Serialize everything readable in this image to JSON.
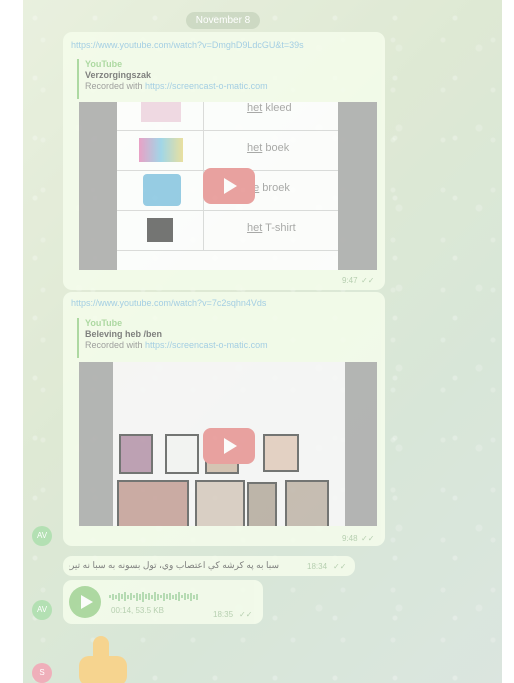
{
  "date_separator": "November 8",
  "messages": [
    {
      "link": "https://www.youtube.com/watch?v=DmghD9LdcGU&t=39s",
      "site": "YouTube",
      "title": "Verzorgingszak",
      "desc_prefix": "Recorded with ",
      "desc_link": "https://screencast-o-matic.com",
      "time": "9:47",
      "video_rows": [
        {
          "article": "het",
          "noun": " kleed"
        },
        {
          "article": "het",
          "noun": " boek"
        },
        {
          "article": "de",
          "noun": " broek"
        },
        {
          "article": "het",
          "noun": " T-shirt"
        }
      ]
    },
    {
      "link": "https://www.youtube.com/watch?v=7c2sqhn4Vds",
      "site": "YouTube",
      "title": "Beleving heb /ben",
      "desc_prefix": "Recorded with ",
      "desc_link": "https://screencast-o-matic.com",
      "time": "9:48"
    },
    {
      "text": "سبا به په کرشه کې اعتصاب وي، تول بسونه به سبا نه تيريږي.",
      "time": "18:34"
    },
    {
      "voice_meta": "00:14, 53.5 KB",
      "time": "18:35"
    }
  ],
  "avatars": [
    {
      "initials": "AV",
      "color": "#8fd18f"
    },
    {
      "initials": "AV",
      "color": "#8fd18f"
    },
    {
      "initials": "S",
      "color": "#e88a9a"
    }
  ],
  "colors": {
    "bubble": "#effbe2",
    "accent": "#7fc46d",
    "link": "#6fb3d8",
    "play": "#e06a6a"
  }
}
